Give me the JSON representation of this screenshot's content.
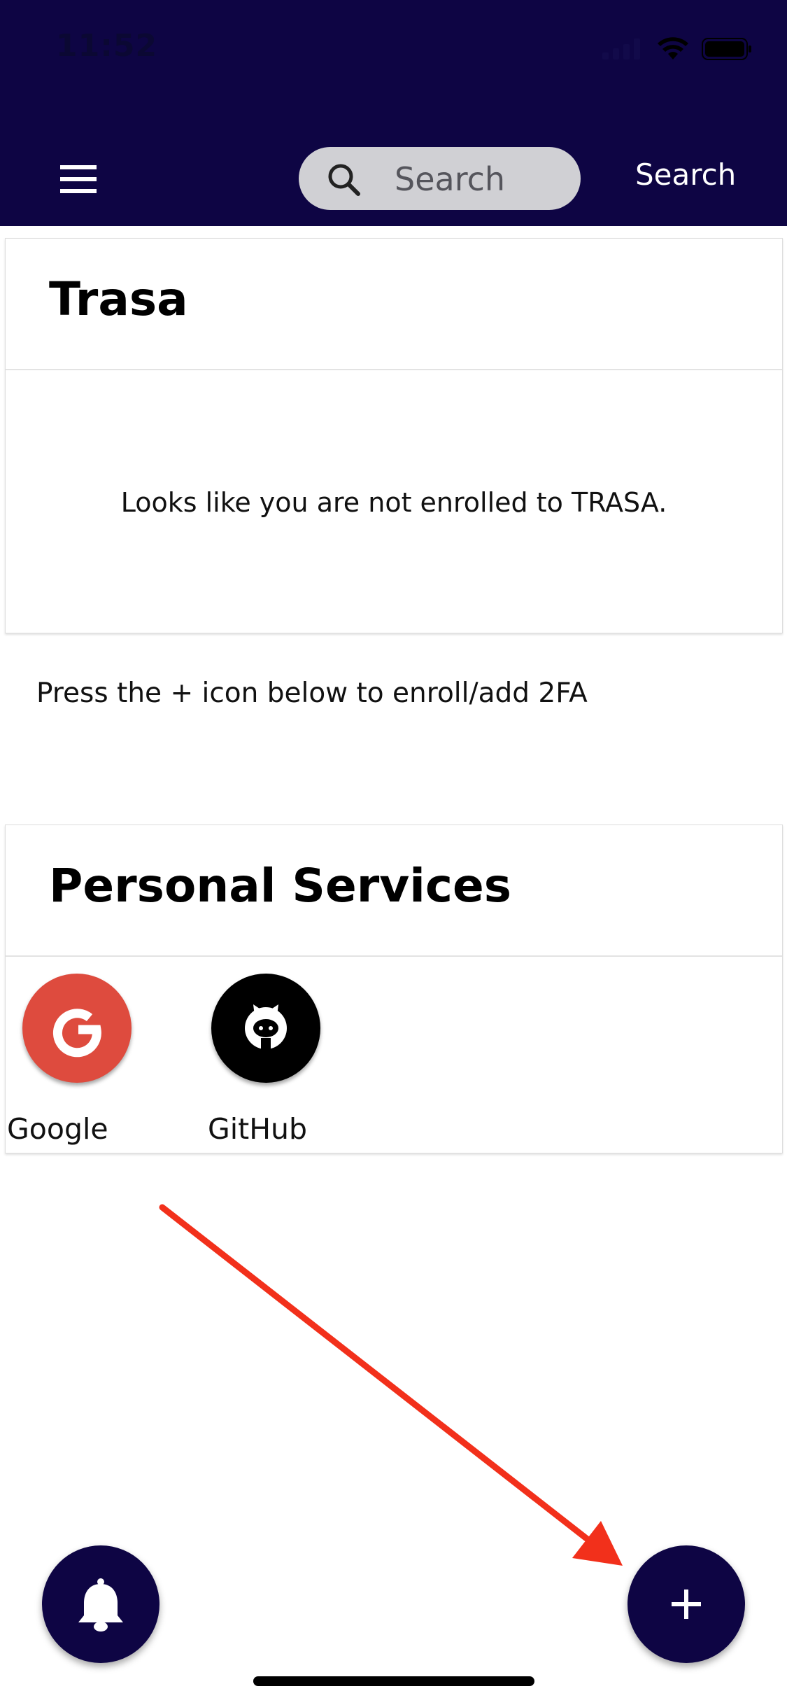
{
  "status_bar": {
    "time": "11:52"
  },
  "header": {
    "menu_icon": "hamburger-menu-icon",
    "search_placeholder": "Search",
    "search_action_label": "Search",
    "background_color": "#0e0544"
  },
  "trasa_card": {
    "title": "Trasa",
    "message": "Looks like you are not enrolled to TRASA."
  },
  "enroll_hint": "Press the + icon below to enroll/add 2FA",
  "personal_services": {
    "title": "Personal Services",
    "items": [
      {
        "label": "Google",
        "icon": "google-g-icon",
        "color": "#de4b3e"
      },
      {
        "label": "GitHub",
        "icon": "github-octocat-icon",
        "color": "#000000"
      }
    ]
  },
  "annotation": {
    "arrow_color": "#f2301b",
    "arrow_icon": "red-arrow-pointing-to-add-button"
  },
  "fab": {
    "notifications_icon": "bell-icon",
    "add_icon": "plus-icon",
    "color": "#0e0544"
  }
}
